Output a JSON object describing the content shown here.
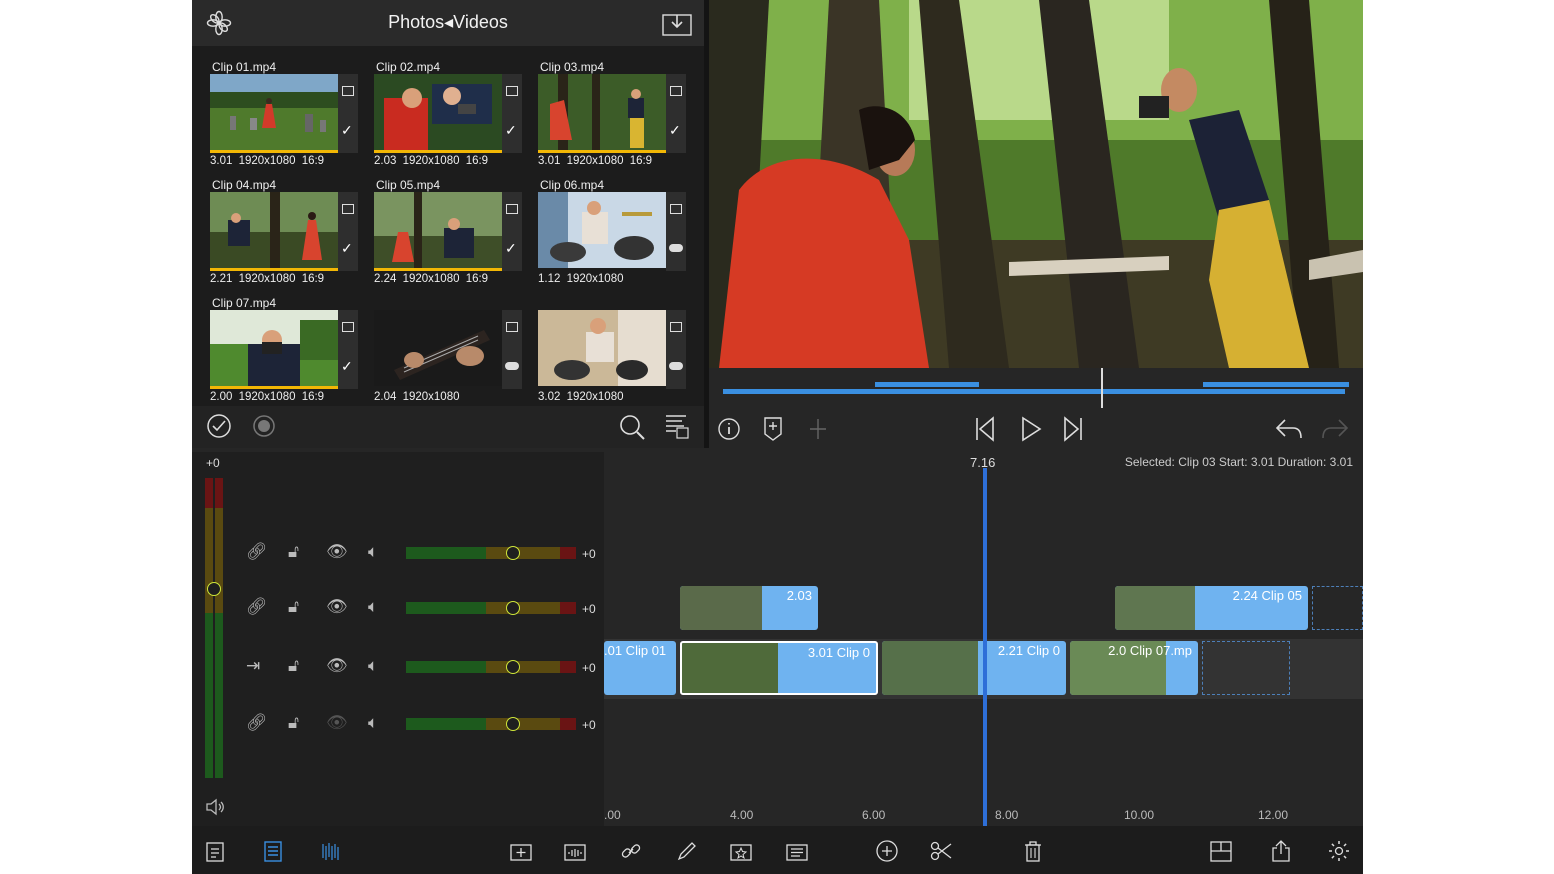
{
  "browser": {
    "title": "Photos◂Videos",
    "clips": [
      {
        "name": "Clip 01.mp4",
        "meta": "3.01  1920x1080  16:9",
        "state": "check"
      },
      {
        "name": "Clip 02.mp4",
        "meta": "2.03  1920x1080  16:9",
        "state": "check"
      },
      {
        "name": "Clip 03.mp4",
        "meta": "3.01  1920x1080  16:9",
        "state": "check"
      },
      {
        "name": "Clip 04.mp4",
        "meta": "2.21  1920x1080  16:9",
        "state": "check"
      },
      {
        "name": "Clip 05.mp4",
        "meta": "2.24  1920x1080  16:9",
        "state": "check"
      },
      {
        "name": "Clip 06.mp4",
        "meta": "1.12  1920x1080",
        "state": "cloud"
      },
      {
        "name": "Clip 07.mp4",
        "meta": "2.00  1920x1080  16:9",
        "state": "check"
      },
      {
        "name": "",
        "meta": "2.04  1920x1080",
        "state": "cloud"
      },
      {
        "name": "",
        "meta": "3.02  1920x1080",
        "state": "cloud"
      }
    ]
  },
  "timeline": {
    "playhead_time": "7.16",
    "selection_info": "Selected: Clip 03 Start: 3.01 Duration: 3.01",
    "master_level": "+0",
    "tracks": [
      {
        "level": "+0",
        "link_icon": "link-icon"
      },
      {
        "level": "+0",
        "link_icon": "link-icon"
      },
      {
        "level": "+0",
        "link_icon": "arrow-right-bar-icon"
      },
      {
        "level": "+0",
        "link_icon": "link-icon"
      }
    ],
    "ruler": [
      ".00",
      "4.00",
      "6.00",
      "8.00",
      "10.00",
      "12.00"
    ],
    "clips": {
      "upper_a": "2.03",
      "upper_b": "2.24   Clip 05",
      "main_a": ".01   Clip 01",
      "main_b": "3.01   Clip 0",
      "main_c": "2.21   Clip 0",
      "main_d": "2.0    Clip 07.mp"
    }
  },
  "colors": {
    "accent": "#2e6fd8",
    "clip": "#6fb3f0",
    "selection": "#f2b705"
  }
}
